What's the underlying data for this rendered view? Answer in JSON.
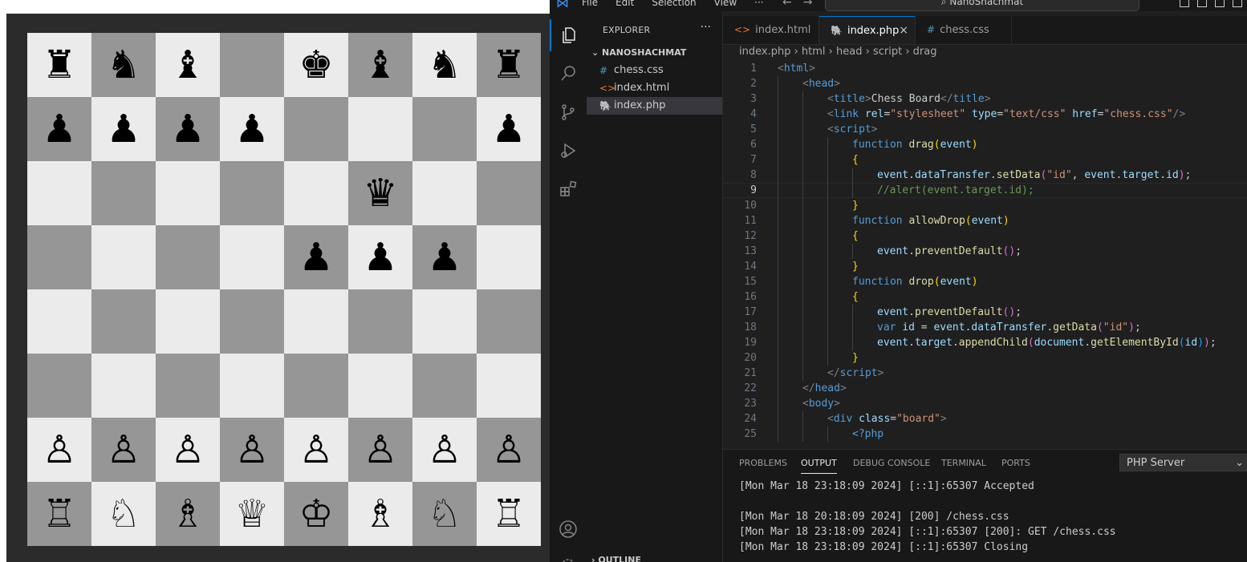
{
  "board": {
    "rows": [
      [
        "♜",
        "♞",
        "♝",
        "",
        "♚",
        "♝",
        "♞",
        "♜"
      ],
      [
        "♟",
        "♟",
        "♟",
        "♟",
        "",
        "",
        "",
        "♟"
      ],
      [
        "",
        "",
        "",
        "",
        "",
        "♛",
        "",
        ""
      ],
      [
        "",
        "",
        "",
        "",
        "♟",
        "♟",
        "♟",
        ""
      ],
      [
        "",
        "",
        "",
        "",
        "",
        "",
        "",
        ""
      ],
      [
        "",
        "",
        "",
        "",
        "",
        "",
        "",
        ""
      ],
      [
        "♙",
        "♙",
        "♙",
        "♙",
        "♙",
        "♙",
        "♙",
        "♙"
      ],
      [
        "♖",
        "♘",
        "♗",
        "♕",
        "♔",
        "♗",
        "♘",
        "♖"
      ]
    ],
    "colors": {
      "light": "#ebebeb",
      "dark": "#969696"
    }
  },
  "titlebar": {
    "menu": [
      "File",
      "Edit",
      "Selection",
      "View",
      "···"
    ],
    "command_center": "NanoShachmat"
  },
  "activity_bar": {
    "icons": [
      "files-icon",
      "search-icon",
      "source-control-icon",
      "run-debug-icon",
      "extensions-icon",
      "account-icon",
      "settings-icon"
    ]
  },
  "explorer": {
    "header": "EXPLORER",
    "more": "···",
    "folder": "NANOSHACHMAT",
    "files": [
      {
        "icon": "#",
        "name": "chess.css",
        "color": "#519aba"
      },
      {
        "icon": "<>",
        "name": "index.html",
        "color": "#e37933"
      },
      {
        "icon": "🐘",
        "name": "index.php",
        "color": "#a074c4"
      }
    ],
    "outline": "OUTLINE"
  },
  "tabs": [
    {
      "icon": "<>",
      "label": "index.html",
      "color": "#e37933"
    },
    {
      "icon": "🐘",
      "label": "index.php",
      "color": "#a074c4",
      "active": true
    },
    {
      "icon": "#",
      "label": "chess.css",
      "color": "#519aba"
    }
  ],
  "breadcrumb": [
    "index.php",
    "html",
    "head",
    "script",
    "drag"
  ],
  "code_lines": [
    {
      "n": "1",
      "indent": 0,
      "t": [
        [
          "tk-punc",
          "<"
        ],
        [
          "tk-tag",
          "html"
        ],
        [
          "tk-punc",
          ">"
        ]
      ]
    },
    {
      "n": "2",
      "indent": 1,
      "t": [
        [
          "tk-punc",
          "<"
        ],
        [
          "tk-tag",
          "head"
        ],
        [
          "tk-punc",
          ">"
        ]
      ]
    },
    {
      "n": "3",
      "indent": 2,
      "t": [
        [
          "tk-punc",
          "<"
        ],
        [
          "tk-tag",
          "title"
        ],
        [
          "tk-punc",
          ">"
        ],
        [
          "tk-txt",
          "Chess Board"
        ],
        [
          "tk-punc",
          "</"
        ],
        [
          "tk-tag",
          "title"
        ],
        [
          "tk-punc",
          ">"
        ]
      ]
    },
    {
      "n": "4",
      "indent": 2,
      "t": [
        [
          "tk-punc",
          "<"
        ],
        [
          "tk-tag",
          "link"
        ],
        [
          "tk-txt",
          " "
        ],
        [
          "tk-attr",
          "rel"
        ],
        [
          "tk-txt",
          "="
        ],
        [
          "tk-str",
          "\"stylesheet\""
        ],
        [
          "tk-txt",
          " "
        ],
        [
          "tk-attr",
          "type"
        ],
        [
          "tk-txt",
          "="
        ],
        [
          "tk-str",
          "\"text/css\""
        ],
        [
          "tk-txt",
          " "
        ],
        [
          "tk-attr",
          "href"
        ],
        [
          "tk-txt",
          "="
        ],
        [
          "tk-str",
          "\"chess.css\""
        ],
        [
          "tk-punc",
          "/>"
        ]
      ]
    },
    {
      "n": "5",
      "indent": 2,
      "t": [
        [
          "tk-punc",
          "<"
        ],
        [
          "tk-tag",
          "script"
        ],
        [
          "tk-punc",
          ">"
        ]
      ]
    },
    {
      "n": "6",
      "indent": 3,
      "t": [
        [
          "tk-kw",
          "function"
        ],
        [
          "tk-txt",
          " "
        ],
        [
          "tk-fn",
          "drag"
        ],
        [
          "tk-br1",
          "("
        ],
        [
          "tk-var",
          "event"
        ],
        [
          "tk-br1",
          ")"
        ]
      ]
    },
    {
      "n": "7",
      "indent": 3,
      "t": [
        [
          "tk-br1",
          "{"
        ]
      ]
    },
    {
      "n": "8",
      "indent": 4,
      "t": [
        [
          "tk-var",
          "event"
        ],
        [
          "tk-txt",
          "."
        ],
        [
          "tk-var",
          "dataTransfer"
        ],
        [
          "tk-txt",
          "."
        ],
        [
          "tk-fn",
          "setData"
        ],
        [
          "tk-br2",
          "("
        ],
        [
          "tk-str",
          "\"id\""
        ],
        [
          "tk-txt",
          ", "
        ],
        [
          "tk-var",
          "event"
        ],
        [
          "tk-txt",
          "."
        ],
        [
          "tk-var",
          "target"
        ],
        [
          "tk-txt",
          "."
        ],
        [
          "tk-var",
          "id"
        ],
        [
          "tk-br2",
          ")"
        ],
        [
          "tk-txt",
          ";"
        ]
      ]
    },
    {
      "n": "9",
      "indent": 4,
      "cur": true,
      "t": [
        [
          "tk-cm",
          "//alert(event.target.id);"
        ]
      ]
    },
    {
      "n": "10",
      "indent": 3,
      "t": [
        [
          "tk-br1",
          "}"
        ]
      ]
    },
    {
      "n": "11",
      "indent": 3,
      "t": [
        [
          "tk-kw",
          "function"
        ],
        [
          "tk-txt",
          " "
        ],
        [
          "tk-fn",
          "allowDrop"
        ],
        [
          "tk-br1",
          "("
        ],
        [
          "tk-var",
          "event"
        ],
        [
          "tk-br1",
          ")"
        ]
      ]
    },
    {
      "n": "12",
      "indent": 3,
      "t": [
        [
          "tk-br1",
          "{"
        ]
      ]
    },
    {
      "n": "13",
      "indent": 4,
      "t": [
        [
          "tk-var",
          "event"
        ],
        [
          "tk-txt",
          "."
        ],
        [
          "tk-fn",
          "preventDefault"
        ],
        [
          "tk-br2",
          "()"
        ],
        [
          "tk-txt",
          ";"
        ]
      ]
    },
    {
      "n": "14",
      "indent": 3,
      "t": [
        [
          "tk-br1",
          "}"
        ]
      ]
    },
    {
      "n": "15",
      "indent": 3,
      "t": [
        [
          "tk-kw",
          "function"
        ],
        [
          "tk-txt",
          " "
        ],
        [
          "tk-fn",
          "drop"
        ],
        [
          "tk-br1",
          "("
        ],
        [
          "tk-var",
          "event"
        ],
        [
          "tk-br1",
          ")"
        ]
      ]
    },
    {
      "n": "16",
      "indent": 3,
      "t": [
        [
          "tk-br1",
          "{"
        ]
      ]
    },
    {
      "n": "17",
      "indent": 4,
      "t": [
        [
          "tk-var",
          "event"
        ],
        [
          "tk-txt",
          "."
        ],
        [
          "tk-fn",
          "preventDefault"
        ],
        [
          "tk-br2",
          "()"
        ],
        [
          "tk-txt",
          ";"
        ]
      ]
    },
    {
      "n": "18",
      "indent": 4,
      "t": [
        [
          "tk-kw",
          "var"
        ],
        [
          "tk-txt",
          " "
        ],
        [
          "tk-var",
          "id"
        ],
        [
          "tk-txt",
          " = "
        ],
        [
          "tk-var",
          "event"
        ],
        [
          "tk-txt",
          "."
        ],
        [
          "tk-var",
          "dataTransfer"
        ],
        [
          "tk-txt",
          "."
        ],
        [
          "tk-fn",
          "getData"
        ],
        [
          "tk-br2",
          "("
        ],
        [
          "tk-str",
          "\"id\""
        ],
        [
          "tk-br2",
          ")"
        ],
        [
          "tk-txt",
          ";"
        ]
      ]
    },
    {
      "n": "19",
      "indent": 4,
      "t": [
        [
          "tk-var",
          "event"
        ],
        [
          "tk-txt",
          "."
        ],
        [
          "tk-var",
          "target"
        ],
        [
          "tk-txt",
          "."
        ],
        [
          "tk-fn",
          "appendChild"
        ],
        [
          "tk-br2",
          "("
        ],
        [
          "tk-var",
          "document"
        ],
        [
          "tk-txt",
          "."
        ],
        [
          "tk-fn",
          "getElementById"
        ],
        [
          "tk-br3",
          "("
        ],
        [
          "tk-var",
          "id"
        ],
        [
          "tk-br3",
          ")"
        ],
        [
          "tk-br2",
          ")"
        ],
        [
          "tk-txt",
          ";"
        ]
      ]
    },
    {
      "n": "20",
      "indent": 3,
      "t": [
        [
          "tk-br1",
          "}"
        ]
      ]
    },
    {
      "n": "21",
      "indent": 2,
      "t": [
        [
          "tk-punc",
          "</"
        ],
        [
          "tk-tag",
          "script"
        ],
        [
          "tk-punc",
          ">"
        ]
      ]
    },
    {
      "n": "22",
      "indent": 1,
      "t": [
        [
          "tk-punc",
          "</"
        ],
        [
          "tk-tag",
          "head"
        ],
        [
          "tk-punc",
          ">"
        ]
      ]
    },
    {
      "n": "23",
      "indent": 1,
      "t": [
        [
          "tk-punc",
          "<"
        ],
        [
          "tk-tag",
          "body"
        ],
        [
          "tk-punc",
          ">"
        ]
      ]
    },
    {
      "n": "24",
      "indent": 2,
      "t": [
        [
          "tk-punc",
          "<"
        ],
        [
          "tk-tag",
          "div"
        ],
        [
          "tk-txt",
          " "
        ],
        [
          "tk-attr",
          "class"
        ],
        [
          "tk-txt",
          "="
        ],
        [
          "tk-str",
          "\"board\""
        ],
        [
          "tk-punc",
          ">"
        ]
      ]
    },
    {
      "n": "25",
      "indent": 3,
      "t": [
        [
          "tk-php",
          "<?php"
        ]
      ]
    }
  ],
  "panel": {
    "tabs": [
      "PROBLEMS",
      "OUTPUT",
      "DEBUG CONSOLE",
      "TERMINAL",
      "PORTS"
    ],
    "active_tab": "OUTPUT",
    "channel": "PHP Server",
    "log_lines": [
      "[Mon Mar 18 23:18:09 2024] [::1]:65307 Accepted",
      "",
      "[Mon Mar 18 20:18:09 2024] [200] /chess.css",
      "[Mon Mar 18 23:18:09 2024] [::1]:65307 [200]: GET /chess.css",
      "[Mon Mar 18 23:18:09 2024] [::1]:65307 Closing"
    ]
  }
}
